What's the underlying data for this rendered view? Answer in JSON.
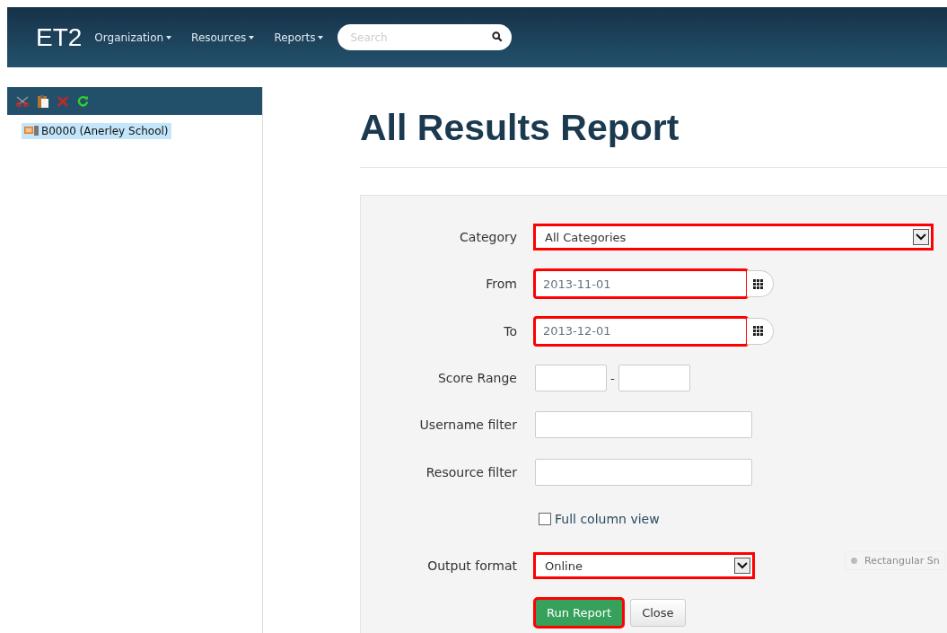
{
  "navbar": {
    "logo": "ET2",
    "menus": [
      {
        "label": "Organization"
      },
      {
        "label": "Resources"
      },
      {
        "label": "Reports"
      }
    ],
    "search": {
      "placeholder": "Search"
    }
  },
  "sidebar": {
    "toolbar": [
      {
        "kind": "cut"
      },
      {
        "kind": "paste"
      },
      {
        "kind": "delete"
      },
      {
        "kind": "refresh"
      }
    ],
    "tree": [
      {
        "label": "B0000 (Anerley School)",
        "selected": true
      }
    ]
  },
  "page": {
    "title": "All Results Report"
  },
  "form": {
    "fields": [
      {
        "kind": "select",
        "label": "Category",
        "value": "All Categories",
        "highlighted": true,
        "wide": true
      },
      {
        "kind": "date",
        "label": "From",
        "value": "2013-11-01",
        "highlighted": true
      },
      {
        "kind": "date",
        "label": "To",
        "value": "2013-12-01",
        "highlighted": true
      },
      {
        "kind": "range",
        "label": "Score Range",
        "separator": "-"
      },
      {
        "kind": "text",
        "label": "Username filter"
      },
      {
        "kind": "text",
        "label": "Resource filter"
      },
      {
        "kind": "checkbox",
        "label": "Full column view",
        "checked": false
      },
      {
        "kind": "select",
        "label": "Output format",
        "value": "Online",
        "highlighted": true,
        "wide": false
      }
    ],
    "buttons": [
      {
        "label": "Run Report",
        "kind": "primary",
        "highlighted": true
      },
      {
        "label": "Close",
        "kind": "default",
        "highlighted": false
      }
    ]
  },
  "overlay": {
    "text": "Rectangular Sn"
  }
}
